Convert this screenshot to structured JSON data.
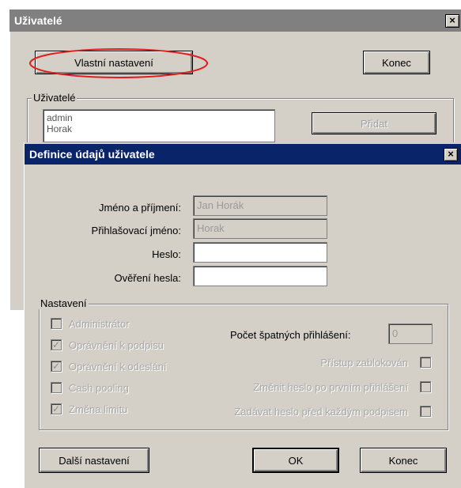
{
  "back_window": {
    "title": "Uživatelé",
    "close": "×",
    "custom_settings_button": "Vlastní nastavení",
    "close_button": "Konec",
    "users_group_label": "Uživatelé",
    "users": [
      "admin",
      "Horak"
    ],
    "add_button": "Přidat"
  },
  "dialog": {
    "title": "Definice údajů uživatele",
    "close": "×",
    "fields": {
      "full_name_label": "Jméno a příjmení:",
      "full_name_value": "Jan Horák",
      "login_label": "Přihlašovací jméno:",
      "login_value": "Horak",
      "password_label": "Heslo:",
      "password_value": "",
      "password_confirm_label": "Ověření hesla:",
      "password_confirm_value": ""
    },
    "settings": {
      "group_label": "Nastavení",
      "left_checkboxes": [
        {
          "label": "Administrátor",
          "checked": false
        },
        {
          "label": "Oprávnění k podpisu",
          "checked": true
        },
        {
          "label": "Oprávnění k odeslání",
          "checked": true
        },
        {
          "label": "Cash pooling",
          "checked": false
        },
        {
          "label": "Změna limitu",
          "checked": true
        }
      ],
      "bad_logins_label": "Počet špatných přihlášení:",
      "bad_logins_value": "0",
      "right_checkboxes": [
        {
          "label": "Přístup zablokován",
          "checked": false
        },
        {
          "label": "Změnit heslo po prvním přihlášení",
          "checked": false
        },
        {
          "label": "Zadávat heslo před každým podpisem",
          "checked": false
        }
      ]
    },
    "more_settings_button": "Další nastavení",
    "ok_button": "OK",
    "close_button": "Konec"
  },
  "colors": {
    "titlebar_active": "#0a246a",
    "titlebar_inactive": "#808080",
    "face": "#d4d0c8",
    "highlight_ellipse": "#e02020"
  }
}
